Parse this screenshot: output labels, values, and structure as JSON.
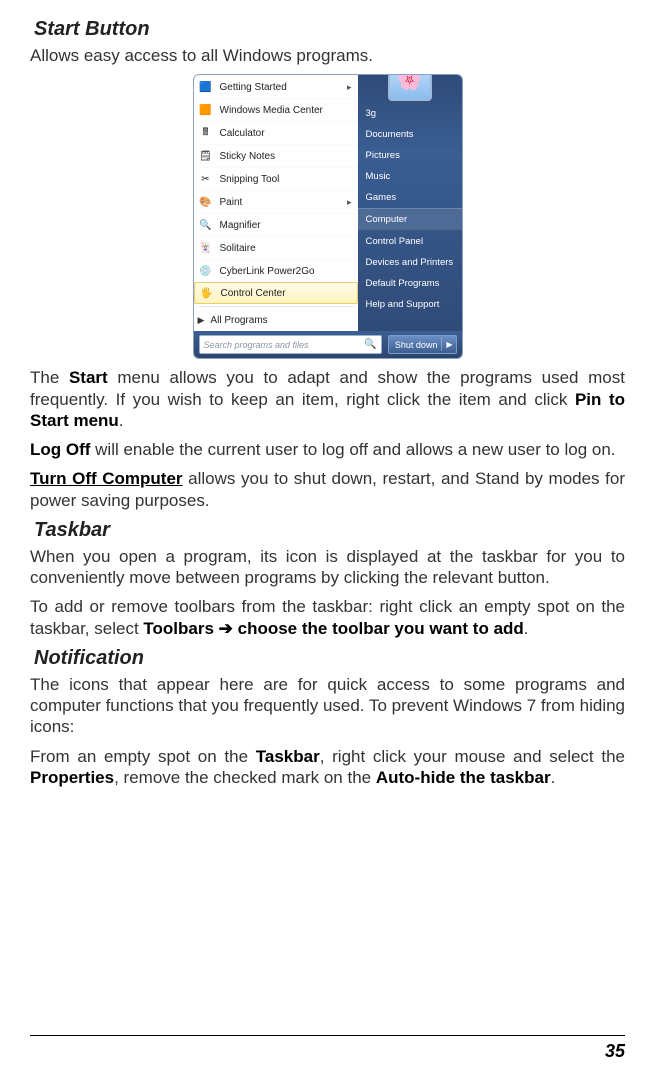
{
  "sections": {
    "startButton": {
      "heading": "Start Button",
      "intro": "Allows easy access to all Windows programs.",
      "p1_a": "The ",
      "p1_b": "Start",
      "p1_c": " menu allows you to adapt and show the programs used most frequently. If you wish to keep an item, right click the item and click ",
      "p1_d": "Pin to Start menu",
      "p1_e": ".",
      "p2_a": "Log Off",
      "p2_b": " will enable the current user to log off and allows a new user to log on.",
      "p3_a": "Turn Off Computer",
      "p3_b": " allows you to shut down, restart, and Stand by modes for power saving purposes."
    },
    "taskbar": {
      "heading": "Taskbar",
      "p1": "When you open a program, its icon is displayed at the taskbar for you to conveniently move between programs by clicking the relevant button.",
      "p2_a": "To add or remove toolbars from the taskbar: right click an empty spot on the taskbar, select ",
      "p2_b": "Toolbars ",
      "p2_arrow": "➔",
      "p2_c": " choose the toolbar you want to add",
      "p2_d": "."
    },
    "notification": {
      "heading": "Notification",
      "p1": "The icons that appear here are for quick access to some programs and computer functions that you frequently used. To prevent Windows 7 from hiding icons:",
      "p2_a": "From an empty spot on the ",
      "p2_b": "Taskbar",
      "p2_c": ", right click your mouse and select the ",
      "p2_d": "Properties",
      "p2_e": ", remove the checked mark on the ",
      "p2_f": "Auto-hide the taskbar",
      "p2_g": "."
    }
  },
  "startMenu": {
    "left": [
      {
        "icon": "🟦",
        "label": "Getting Started",
        "submenu": true
      },
      {
        "icon": "🟧",
        "label": "Windows Media Center"
      },
      {
        "icon": "🖩",
        "label": "Calculator"
      },
      {
        "icon": "🗒",
        "label": "Sticky Notes"
      },
      {
        "icon": "✂",
        "label": "Snipping Tool"
      },
      {
        "icon": "🎨",
        "label": "Paint",
        "submenu": true
      },
      {
        "icon": "🔍",
        "label": "Magnifier"
      },
      {
        "icon": "🃏",
        "label": "Solitaire"
      },
      {
        "icon": "💿",
        "label": "CyberLink Power2Go"
      },
      {
        "icon": "🖐",
        "label": "Control Center",
        "hover": true
      }
    ],
    "allPrograms": "All Programs",
    "right": [
      "3g",
      "Documents",
      "Pictures",
      "Music",
      "Games",
      "Computer",
      "Control Panel",
      "Devices and Printers",
      "Default Programs",
      "Help and Support"
    ],
    "searchPlaceholder": "Search programs and files",
    "shutdown": "Shut down"
  },
  "pageNumber": "35"
}
